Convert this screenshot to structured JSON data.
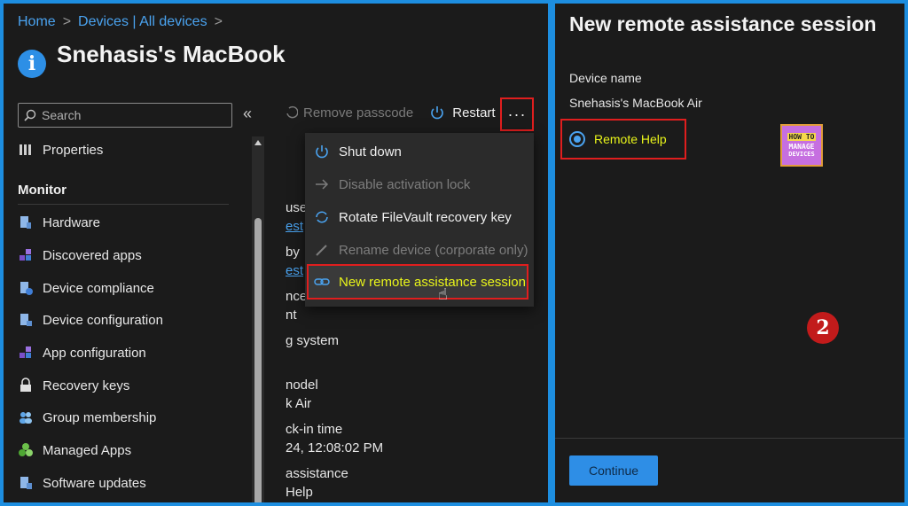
{
  "breadcrumb": {
    "home": "Home",
    "devices": "Devices | All devices",
    "sep": ">"
  },
  "page": {
    "title": "Snehasis's MacBook A"
  },
  "search": {
    "placeholder": "Search",
    "collapse": "«"
  },
  "sidebar": {
    "top_item": "Properties",
    "heading": "Monitor",
    "items": [
      {
        "label": "Hardware",
        "icon": "hardware-icon"
      },
      {
        "label": "Discovered apps",
        "icon": "apps-icon"
      },
      {
        "label": "Device compliance",
        "icon": "compliance-icon"
      },
      {
        "label": "Device configuration",
        "icon": "configuration-icon"
      },
      {
        "label": "App configuration",
        "icon": "app-config-icon"
      },
      {
        "label": "Recovery keys",
        "icon": "lock-icon"
      },
      {
        "label": "Group membership",
        "icon": "group-icon"
      },
      {
        "label": "Managed Apps",
        "icon": "managed-apps-icon"
      },
      {
        "label": "Software updates",
        "icon": "updates-icon"
      }
    ]
  },
  "toolbar": {
    "remove_passcode": "Remove passcode",
    "restart": "Restart",
    "more": "···"
  },
  "content_fragments": [
    {
      "text": "use",
      "link": false
    },
    {
      "text": "est",
      "link": true
    },
    {
      "text": "by",
      "link": false
    },
    {
      "text": "est",
      "link": true
    },
    {
      "text": "nce",
      "link": false
    },
    {
      "text": "nt",
      "link": false
    },
    {
      "text": "g system",
      "link": false
    },
    {
      "text": "nodel",
      "link": false
    },
    {
      "text": "k Air",
      "link": false
    },
    {
      "text": "ck-in time",
      "link": false
    },
    {
      "text": "24, 12:08:02 PM",
      "link": false
    },
    {
      "text": "assistance",
      "link": false
    },
    {
      "text": "Help",
      "link": false
    }
  ],
  "menu": {
    "items": [
      {
        "label": "Shut down",
        "enabled": true,
        "icon": "power-icon"
      },
      {
        "label": "Disable activation lock",
        "enabled": false,
        "icon": "arrow-right-icon"
      },
      {
        "label": "Rotate FileVault recovery key",
        "enabled": true,
        "icon": "rotate-icon"
      },
      {
        "label": "Rename device (corporate only)",
        "enabled": false,
        "icon": "edit-icon"
      },
      {
        "label": "New remote assistance session",
        "enabled": true,
        "icon": "link-icon"
      }
    ]
  },
  "right_panel": {
    "title": "New remote assistance session",
    "device_label": "Device name",
    "device_name": "Snehasis's MacBook Air",
    "option_label": "Remote Help",
    "continue": "Continue"
  },
  "logo": {
    "line1": "HOW TO",
    "line2": "MANAGE",
    "line3": "DEVICES"
  },
  "step_badge": "2",
  "colors": {
    "accent": "#2e8ee6",
    "highlight_border": "#e01e1e",
    "highlight_text": "#e9f51a",
    "panel_bg": "#1b1b1b"
  }
}
